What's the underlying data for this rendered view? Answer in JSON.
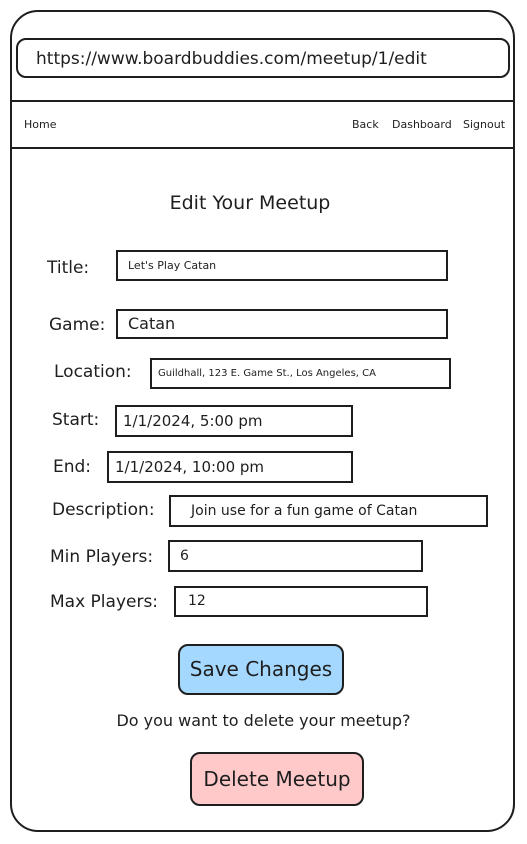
{
  "browser": {
    "url": "https://www.boardbuddies.com/meetup/1/edit"
  },
  "nav": {
    "home": "Home",
    "back": "Back",
    "dashboard": "Dashboard",
    "signout": "Signout"
  },
  "form": {
    "heading": "Edit Your Meetup",
    "title_label": "Title:",
    "title_value": "Let's Play Catan",
    "game_label": "Game:",
    "game_value": "Catan",
    "location_label": "Location:",
    "location_value": "Guildhall, 123 E. Game St., Los Angeles, CA",
    "start_label": "Start:",
    "start_value": "1/1/2024, 5:00 pm",
    "end_label": "End:",
    "end_value": "1/1/2024, 10:00 pm",
    "description_label": "Description:",
    "description_value": "Join use for a fun game of Catan",
    "min_players_label": "Min Players:",
    "min_players_value": "6",
    "max_players_label": "Max Players:",
    "max_players_value": "12",
    "save_label": "Save Changes"
  },
  "delete": {
    "question": "Do you want to delete your meetup?",
    "button_label": "Delete Meetup"
  },
  "colors": {
    "save_button": "#a5d8ff",
    "delete_button": "#ffc9c9"
  }
}
